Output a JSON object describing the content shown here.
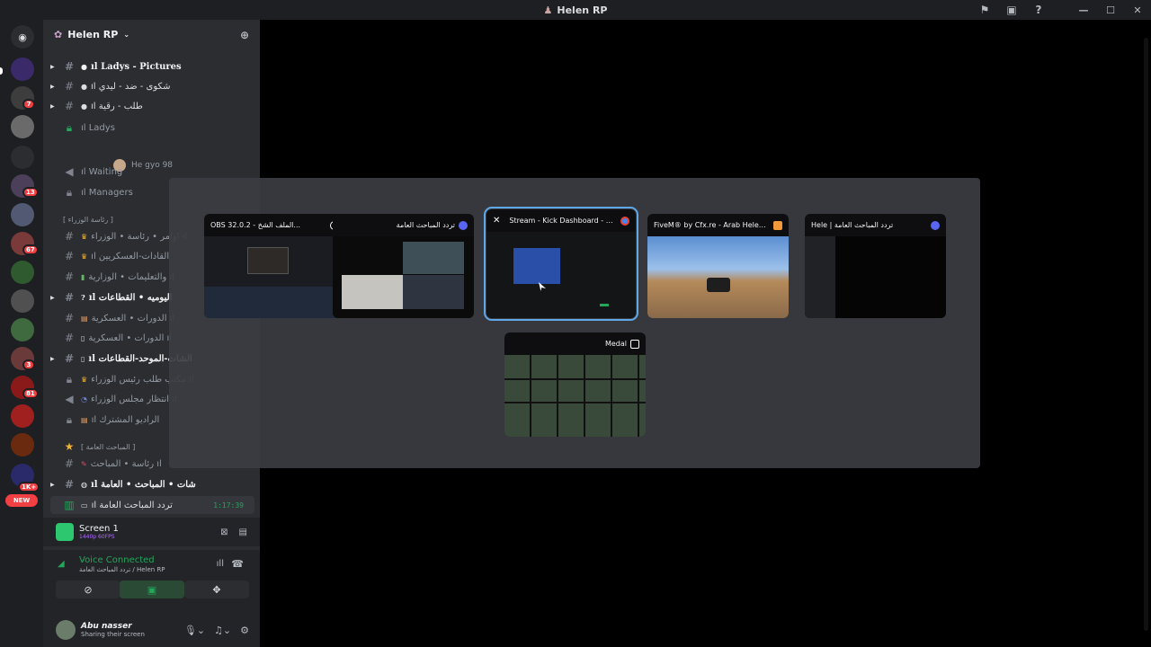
{
  "window": {
    "title": "Helen RP",
    "flag_icon": "flag-icon",
    "inbox_icon": "inbox-icon",
    "help_icon": "help-icon"
  },
  "server": {
    "name": "Helen RP"
  },
  "channels": [
    {
      "label": "ıl  Ladys - Pictures",
      "bold": true
    },
    {
      "label": "ıl شكوى - ضد - ليدي",
      "bold": false
    },
    {
      "label": "ıl طلب - رقية",
      "bold": false
    },
    {
      "label": "ıl Ladys",
      "bold": false
    },
    {
      "label": "ıl Waiting",
      "bold": false
    },
    {
      "label": "ıl Managers",
      "bold": false
    },
    {
      "label": "[ رئاسة الوزراء ]",
      "bold": false
    },
    {
      "label": "اوامر • رئاسة • الوزراء ıl",
      "bold": false
    },
    {
      "label": "ıl القادات-العسكريين",
      "bold": false
    },
    {
      "label": "والتعليمات • الوزارية ıl",
      "bold": false
    },
    {
      "label": "ıl اليوميه • القطاعات",
      "bold": true
    },
    {
      "label": "الدورات • العسكرية ıl",
      "bold": false
    },
    {
      "label": "الدورات • العسكرية ıl",
      "bold": false
    },
    {
      "label": "ıl الشات-الموحد-القطاعات",
      "bold": true
    },
    {
      "label": "مكتب طلب رئيس الوزراء ıl",
      "bold": false
    },
    {
      "label": "انتظار مجلس الوزراء ıl",
      "bold": false
    },
    {
      "label": "ıl الراديو المشترك",
      "bold": false
    },
    {
      "label": "[ المباحث العامة ]",
      "bold": false
    },
    {
      "label": "رئاسة • المباحث ıl",
      "bold": false
    },
    {
      "label": "ıl شات • المباحث • العامة",
      "bold": true
    },
    {
      "label": "ıl تردد المباحث العامة",
      "bold": false
    }
  ],
  "voice_user": {
    "name": "He gyo 98"
  },
  "stream_time": "1:17:39",
  "stream": {
    "name": "Screen 1",
    "quality": "1440p 60FPS"
  },
  "voice": {
    "status": "Voice Connected",
    "channel": "تردد المباحث العامة / Helen RP"
  },
  "user": {
    "name": "Abu nasser",
    "status": "Sharing their screen"
  },
  "badges": {
    "new": "NEW",
    "b1": "7",
    "b2": "13",
    "b3": "67",
    "b4": "3",
    "b5": "81",
    "b6": "1K+"
  },
  "picker_windows": [
    {
      "title": "OBS 32.0.2 - الملف الشخ...",
      "app_color": "#ffffff"
    },
    {
      "title": "تردد المباحث العامة",
      "app_color": "#5865f2"
    },
    {
      "title": "Stream - Kick Dashboard - G...",
      "app_color": "#4285f4"
    },
    {
      "title": "FiveM® by Cfx.re - Arab Helen...",
      "app_color": "#f29a3a"
    },
    {
      "title": "Hele | تردد المباحث العامة",
      "app_color": "#5865f2"
    },
    {
      "title": "Medal",
      "app_color": "#ffffff"
    }
  ]
}
